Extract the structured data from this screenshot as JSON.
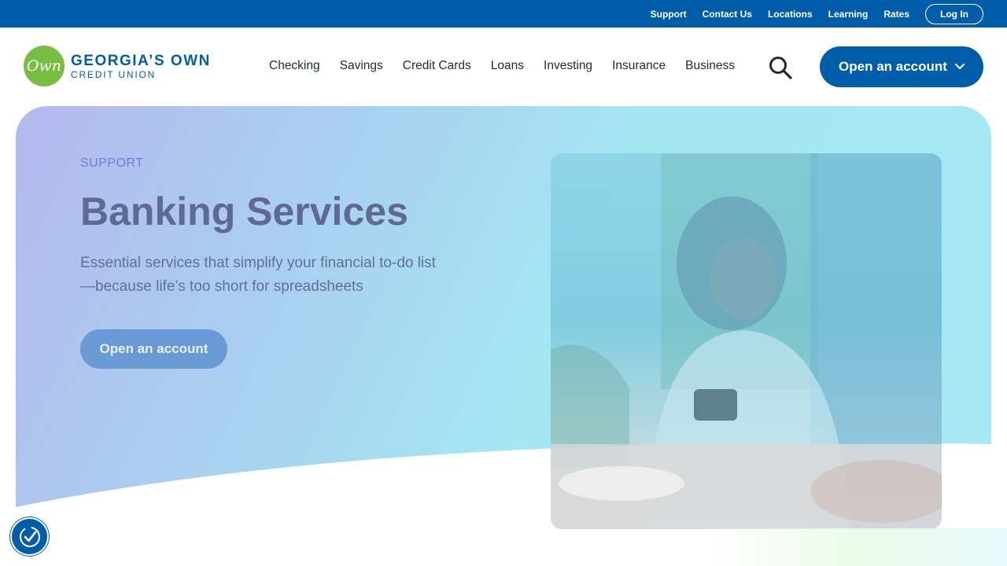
{
  "utility_bar": {
    "links": [
      "Support",
      "Contact Us",
      "Locations",
      "Learning",
      "Rates"
    ],
    "login_label": "Log In",
    "bg_color": "#005daa"
  },
  "brand": {
    "logo_mark": "Own",
    "name_line1": "GEORGIA’S OWN",
    "name_line2": "CREDIT UNION",
    "logo_green": "#78be43",
    "brand_blue": "#005daa"
  },
  "nav": {
    "items": [
      "Checking",
      "Savings",
      "Credit Cards",
      "Loans",
      "Investing",
      "Insurance",
      "Business"
    ],
    "search_icon": "search-icon",
    "cta_label": "Open an account",
    "cta_icon": "chevron-down-icon"
  },
  "hero": {
    "eyebrow": "SUPPORT",
    "title": "Banking Services",
    "subtitle": "Essential services that simplify your financial to-do list—because life’s too short for spreadsheets",
    "cta_label": "Open an account",
    "image_icon": "photo-woman-using-phone"
  },
  "accessibility": {
    "icon": "accessibility-check-icon"
  }
}
